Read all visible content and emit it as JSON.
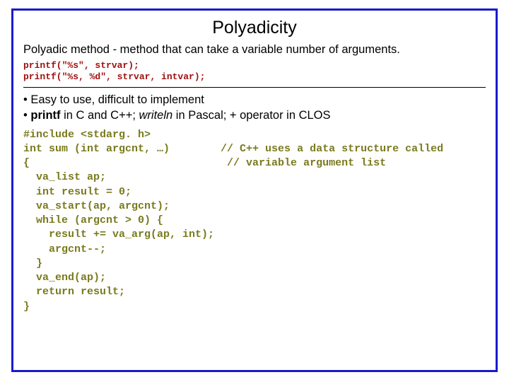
{
  "title": "Polyadicity",
  "description": "Polyadic method - method that can take a variable number of arguments.",
  "example_calls": "printf(\"%s\", strvar);\nprintf(\"%s, %d\", strvar, intvar);",
  "bullets": [
    {
      "pre": "Easy to use, difficult to implement",
      "mono": "",
      "post": ""
    },
    {
      "pre": "",
      "mono": "printf",
      "mid1": " in C and C++; ",
      "mono2": "writeln",
      "mid2": " in Pascal; + operator in CLOS"
    }
  ],
  "code": "#include <stdarg. h>\nint sum (int argcnt, …)        // C++ uses a data structure called\n{                               // variable argument list\n  va_list ap;\n  int result = 0;\n  va_start(ap, argcnt);\n  while (argcnt > 0) {\n    result += va_arg(ap, int);\n    argcnt--;\n  }\n  va_end(ap);\n  return result;\n}"
}
